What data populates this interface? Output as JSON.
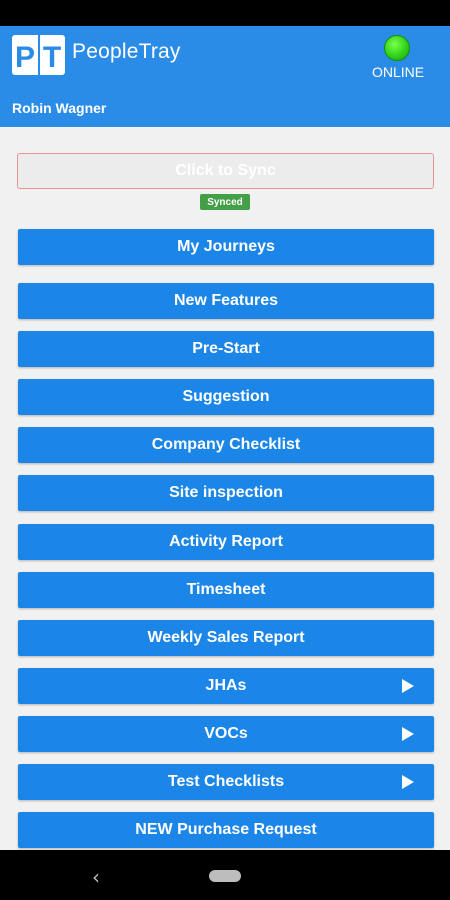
{
  "app": {
    "name": "PeopleTray",
    "logo_text": "PT",
    "status": "ONLINE",
    "status_color": "#33d21f",
    "accent_color": "#1c86e8"
  },
  "user": {
    "name": "Robin Wagner"
  },
  "sync": {
    "label": "Click to Sync",
    "badge": "Synced"
  },
  "menu": [
    {
      "label": "My Journeys",
      "has_arrow": false
    },
    {
      "label": "New Features",
      "has_arrow": false
    },
    {
      "label": "Pre-Start",
      "has_arrow": false
    },
    {
      "label": "Suggestion",
      "has_arrow": false
    },
    {
      "label": "Company Checklist",
      "has_arrow": false
    },
    {
      "label": "Site inspection",
      "has_arrow": false
    },
    {
      "label": "Activity Report",
      "has_arrow": false
    },
    {
      "label": "Timesheet",
      "has_arrow": false
    },
    {
      "label": "Weekly Sales Report",
      "has_arrow": false
    },
    {
      "label": "JHAs",
      "has_arrow": true
    },
    {
      "label": "VOCs",
      "has_arrow": true
    },
    {
      "label": "Test Checklists",
      "has_arrow": true
    },
    {
      "label": "NEW Purchase Request",
      "has_arrow": false
    }
  ],
  "navigation": {
    "back_icon": "back-icon",
    "home_icon": "home-pill-icon"
  }
}
